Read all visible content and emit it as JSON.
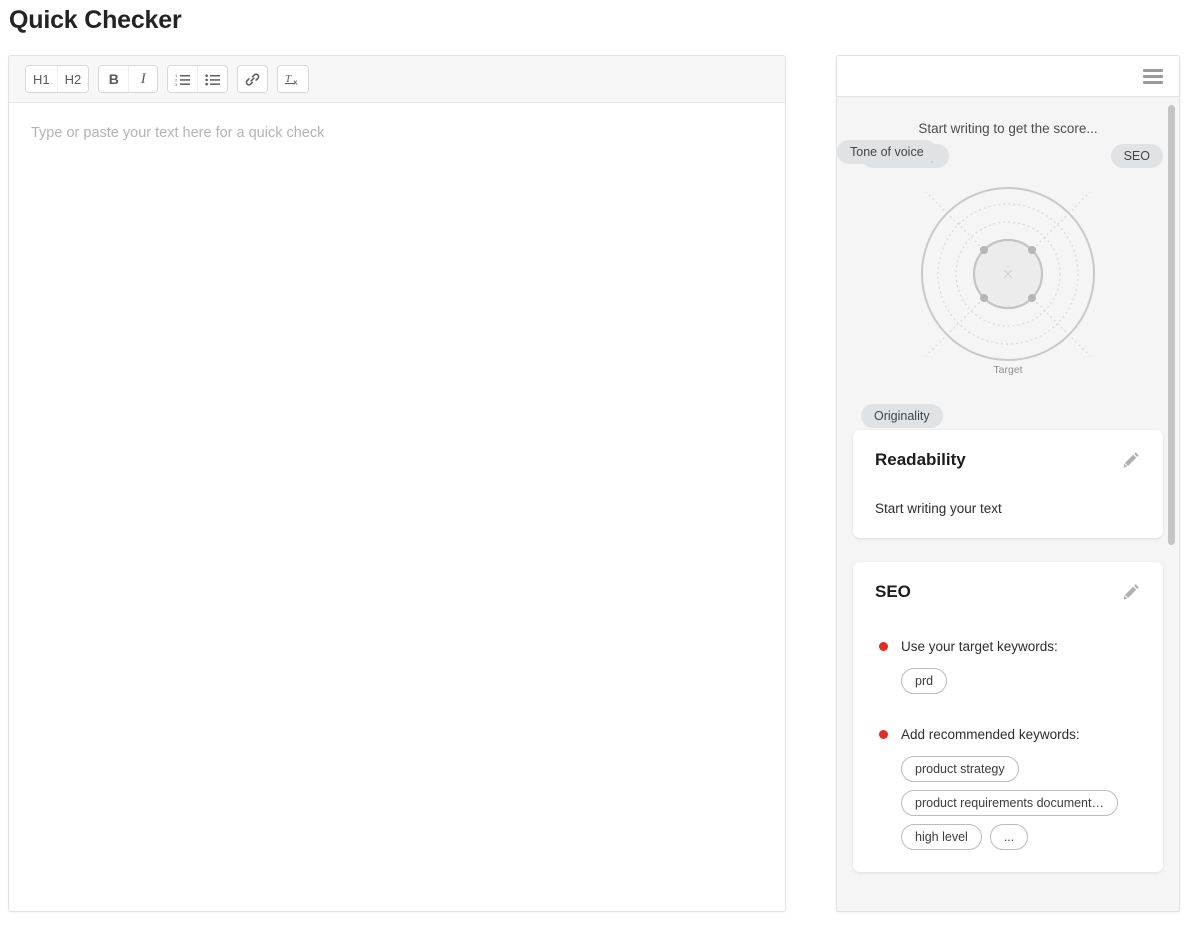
{
  "page": {
    "title": "Quick Checker"
  },
  "editor": {
    "toolbar": {
      "groups": [
        {
          "buttons": [
            {
              "name": "heading-1-button",
              "label": "H1"
            },
            {
              "name": "heading-2-button",
              "label": "H2"
            }
          ]
        },
        {
          "buttons": [
            {
              "name": "bold-button",
              "label": "B"
            },
            {
              "name": "italic-button",
              "label": "I"
            }
          ]
        },
        {
          "buttons": [
            {
              "name": "ordered-list-button",
              "label": "ordered-list-icon"
            },
            {
              "name": "unordered-list-button",
              "label": "unordered-list-icon"
            }
          ]
        },
        {
          "buttons": [
            {
              "name": "link-button",
              "label": "link-icon"
            }
          ]
        },
        {
          "buttons": [
            {
              "name": "clear-formatting-button",
              "label": "Tx"
            }
          ]
        }
      ]
    },
    "placeholder": "Type or paste your text here for a quick check",
    "value": ""
  },
  "insights": {
    "menu_icon": "hamburger-menu-icon",
    "score_caption": "Start writing to get the score...",
    "radar": {
      "target_label": "Target",
      "axes": [
        {
          "name": "readability",
          "label": "Readability"
        },
        {
          "name": "seo",
          "label": "SEO"
        },
        {
          "name": "originality",
          "label": "Originality"
        },
        {
          "name": "tone-of-voice",
          "label": "Tone of voice"
        }
      ]
    },
    "cards": [
      {
        "name": "readability-card",
        "title": "Readability",
        "edit_icon": "pencil-icon",
        "text": "Start writing your text"
      },
      {
        "name": "seo-card",
        "title": "SEO",
        "edit_icon": "pencil-icon",
        "items": [
          {
            "name": "target-keywords",
            "status_color": "#e8291f",
            "label": "Use your target keywords:",
            "chips": [
              "prd"
            ]
          },
          {
            "name": "recommended-keywords",
            "status_color": "#e8291f",
            "label": "Add recommended keywords:",
            "chips": [
              "product strategy",
              "product requirements document…",
              "high level",
              "..."
            ]
          }
        ]
      }
    ]
  }
}
